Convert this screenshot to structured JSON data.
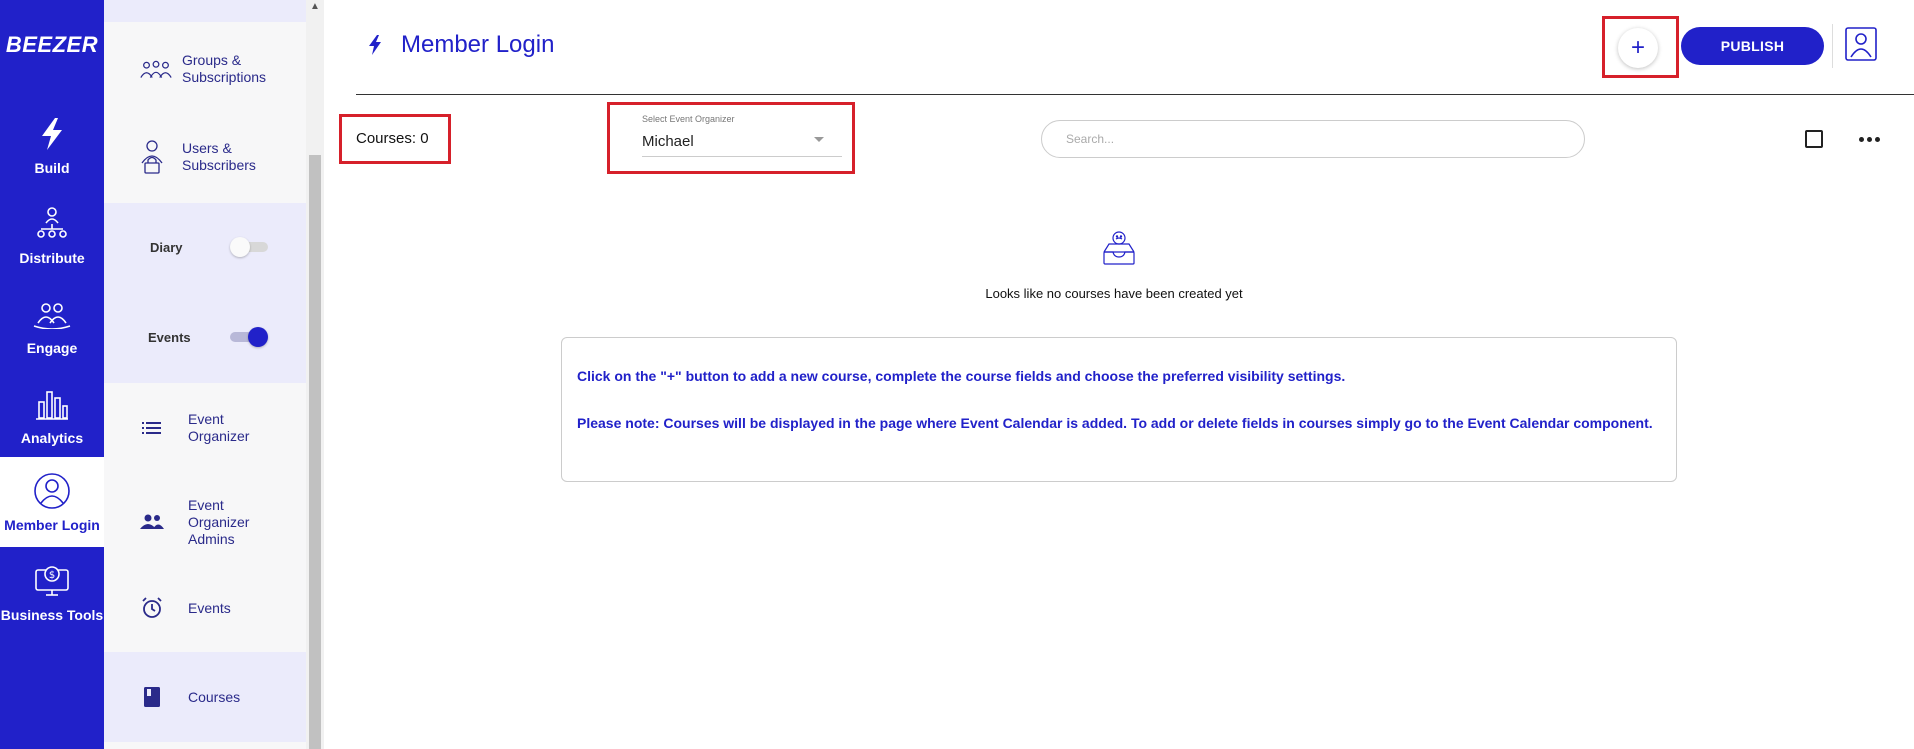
{
  "brand": {
    "logo_text": "BEEZER",
    "accent": "#2121c9",
    "highlight": "#d6202a"
  },
  "rail": {
    "items": [
      {
        "label": "Build",
        "icon": "lightning-icon"
      },
      {
        "label": "Distribute",
        "icon": "org-chart-icon"
      },
      {
        "label": "Engage",
        "icon": "people-icon"
      },
      {
        "label": "Analytics",
        "icon": "bar-chart-icon"
      },
      {
        "label": "Member Login",
        "icon": "user-circle-icon",
        "active": true
      },
      {
        "label": "Business Tools",
        "icon": "monitor-dollar-icon"
      }
    ]
  },
  "panel": {
    "groups_label": "Groups & Subscriptions",
    "users_label": "Users & Subscribers",
    "diary": {
      "label": "Diary",
      "on": false
    },
    "events_toggle": {
      "label": "Events",
      "on": true
    },
    "event_organizer_label": "Event Organizer",
    "event_organizer_admins_label": "Event Organizer Admins",
    "events_label": "Events",
    "courses_label": "Courses"
  },
  "header": {
    "title": "Member Login",
    "add_label": "+",
    "publish_label": "PUBLISH"
  },
  "toolbar": {
    "courses_count": "Courses: 0",
    "organizer_select_label": "Select Event Organizer",
    "organizer_value": "Michael",
    "search_placeholder": "Search..."
  },
  "empty_state": {
    "message": "Looks like no courses have been created yet"
  },
  "info": {
    "line1": "Click on the \"+\" button to add a new course, complete the course fields and choose the preferred visibility settings.",
    "line2": "Please note: Courses will be displayed in the page where Event Calendar is added. To add or delete fields in courses simply go to the Event Calendar component."
  }
}
